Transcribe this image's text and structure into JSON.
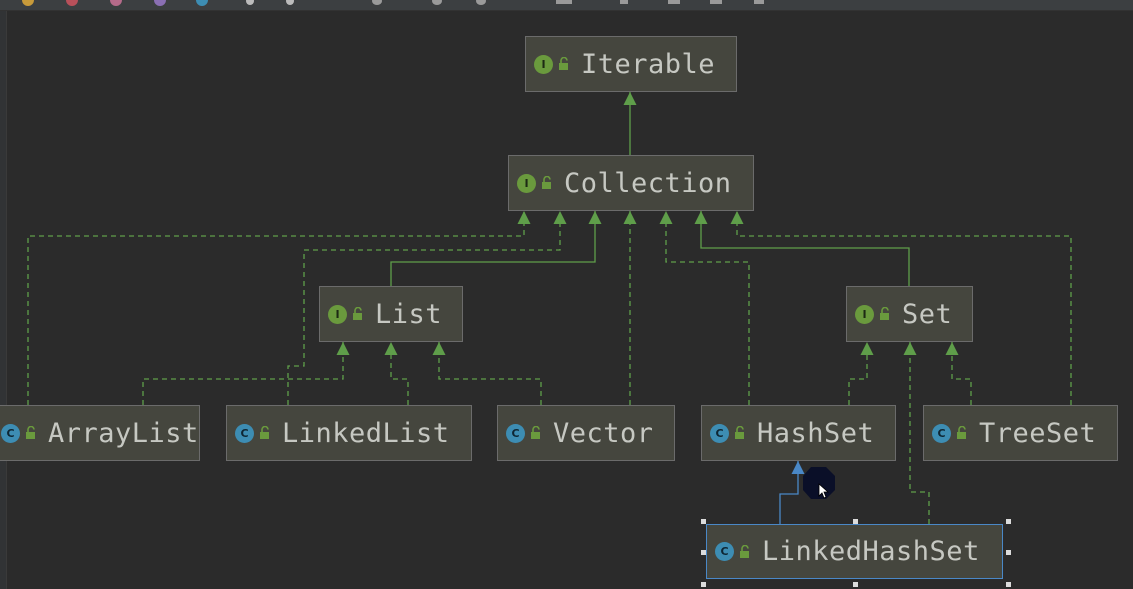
{
  "diagram": {
    "nodes": [
      {
        "id": "iterable",
        "label": "Iterable",
        "kind": "interface"
      },
      {
        "id": "collection",
        "label": "Collection",
        "kind": "interface"
      },
      {
        "id": "list",
        "label": "List",
        "kind": "interface"
      },
      {
        "id": "set",
        "label": "Set",
        "kind": "interface"
      },
      {
        "id": "arraylist",
        "label": "ArrayList",
        "kind": "class"
      },
      {
        "id": "linkedlist",
        "label": "LinkedList",
        "kind": "class"
      },
      {
        "id": "vector",
        "label": "Vector",
        "kind": "class"
      },
      {
        "id": "hashset",
        "label": "HashSet",
        "kind": "class"
      },
      {
        "id": "treeset",
        "label": "TreeSet",
        "kind": "class"
      },
      {
        "id": "linkedhashset",
        "label": "LinkedHashSet",
        "kind": "class"
      }
    ],
    "edges": [
      {
        "from": "collection",
        "to": "iterable",
        "style": "solid"
      },
      {
        "from": "list",
        "to": "collection",
        "style": "solid"
      },
      {
        "from": "set",
        "to": "collection",
        "style": "solid"
      },
      {
        "from": "arraylist",
        "to": "collection",
        "style": "dashed"
      },
      {
        "from": "linkedlist",
        "to": "collection",
        "style": "dashed"
      },
      {
        "from": "vector",
        "to": "collection",
        "style": "dashed"
      },
      {
        "from": "hashset",
        "to": "collection",
        "style": "dashed"
      },
      {
        "from": "treeset",
        "to": "collection",
        "style": "dashed"
      },
      {
        "from": "arraylist",
        "to": "list",
        "style": "dashed"
      },
      {
        "from": "linkedlist",
        "to": "list",
        "style": "dashed"
      },
      {
        "from": "vector",
        "to": "list",
        "style": "dashed"
      },
      {
        "from": "hashset",
        "to": "set",
        "style": "dashed"
      },
      {
        "from": "treeset",
        "to": "set",
        "style": "dashed"
      },
      {
        "from": "linkedhashset",
        "to": "set",
        "style": "dashed"
      },
      {
        "from": "linkedhashset",
        "to": "hashset",
        "style": "solid-blue"
      }
    ],
    "selected": "linkedhashset",
    "badge_letters": {
      "interface": "I",
      "class": "C"
    },
    "colors": {
      "background": "#2b2b2b",
      "node_fill": "#45463e",
      "edge_green": "#5f9e4a",
      "edge_blue": "#4a88c7",
      "interface_badge": "#6a9a3d",
      "class_badge": "#3d8db3"
    }
  },
  "icons": {
    "node_access": "lock-open-icon",
    "pointer": "mouse-cursor-icon"
  }
}
